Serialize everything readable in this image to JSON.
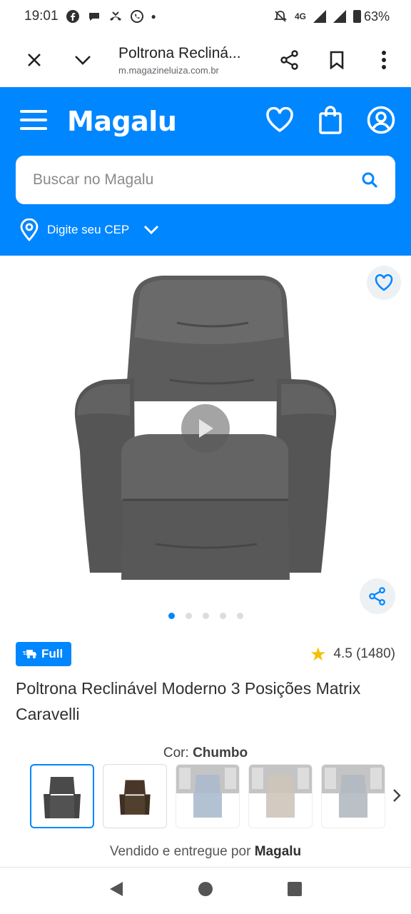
{
  "status": {
    "time": "19:01",
    "network": "4G",
    "battery": "63%"
  },
  "browser": {
    "tab_title": "Poltrona Recliná...",
    "domain": "m.magazineluiza.com.br"
  },
  "header": {
    "logo": "Magalu",
    "search_placeholder": "Buscar no Magalu",
    "cep_label": "Digite seu CEP",
    "brand_color": "#0086ff"
  },
  "product": {
    "badge": "Full",
    "rating": "4.5 (1480)",
    "title": "Poltrona Reclinável Moderno 3 Posições Matrix Caravelli",
    "color_label": "Cor:",
    "color_value": "Chumbo",
    "image_count": 5,
    "active_image": 1,
    "thumbnails": [
      "chumbo",
      "marrom",
      "azul",
      "bege",
      "cinza"
    ],
    "sold_by_prefix": "Vendido e entregue por",
    "sold_by": "Magalu"
  }
}
